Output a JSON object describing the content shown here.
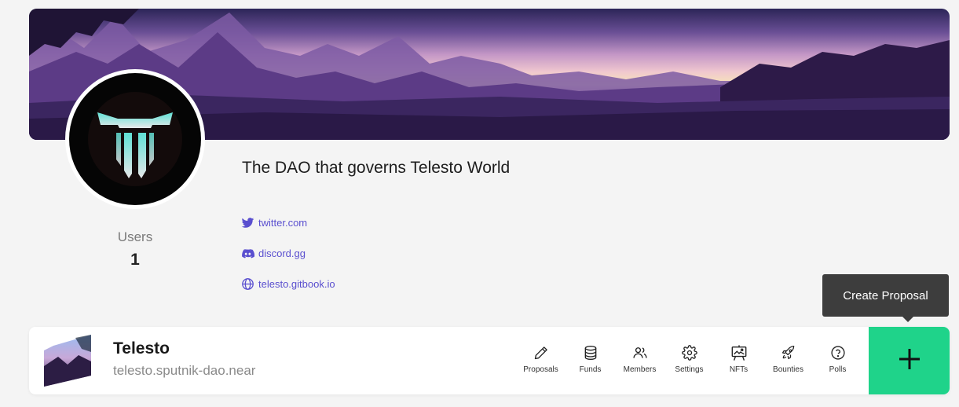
{
  "dao": {
    "description": "The DAO that governs Telesto World",
    "name": "Telesto",
    "address": "telesto.sputnik-dao.near"
  },
  "stats": {
    "users_label": "Users",
    "users_count": "1"
  },
  "links": [
    {
      "label": "twitter.com",
      "icon": "twitter-icon"
    },
    {
      "label": "discord.gg",
      "icon": "discord-icon"
    },
    {
      "label": "telesto.gitbook.io",
      "icon": "globe-icon"
    }
  ],
  "nav": [
    {
      "label": "Proposals",
      "icon": "pencil-icon"
    },
    {
      "label": "Funds",
      "icon": "database-icon"
    },
    {
      "label": "Members",
      "icon": "users-icon"
    },
    {
      "label": "Settings",
      "icon": "gear-icon"
    },
    {
      "label": "NFTs",
      "icon": "easel-icon"
    },
    {
      "label": "Bounties",
      "icon": "rocket-icon"
    },
    {
      "label": "Polls",
      "icon": "question-circle-icon"
    }
  ],
  "create": {
    "tooltip": "Create Proposal",
    "icon": "plus-icon"
  },
  "colors": {
    "accent_green": "#1fd38a",
    "link_purple": "#5a4fcf",
    "tooltip_bg": "#3d3d3d"
  }
}
